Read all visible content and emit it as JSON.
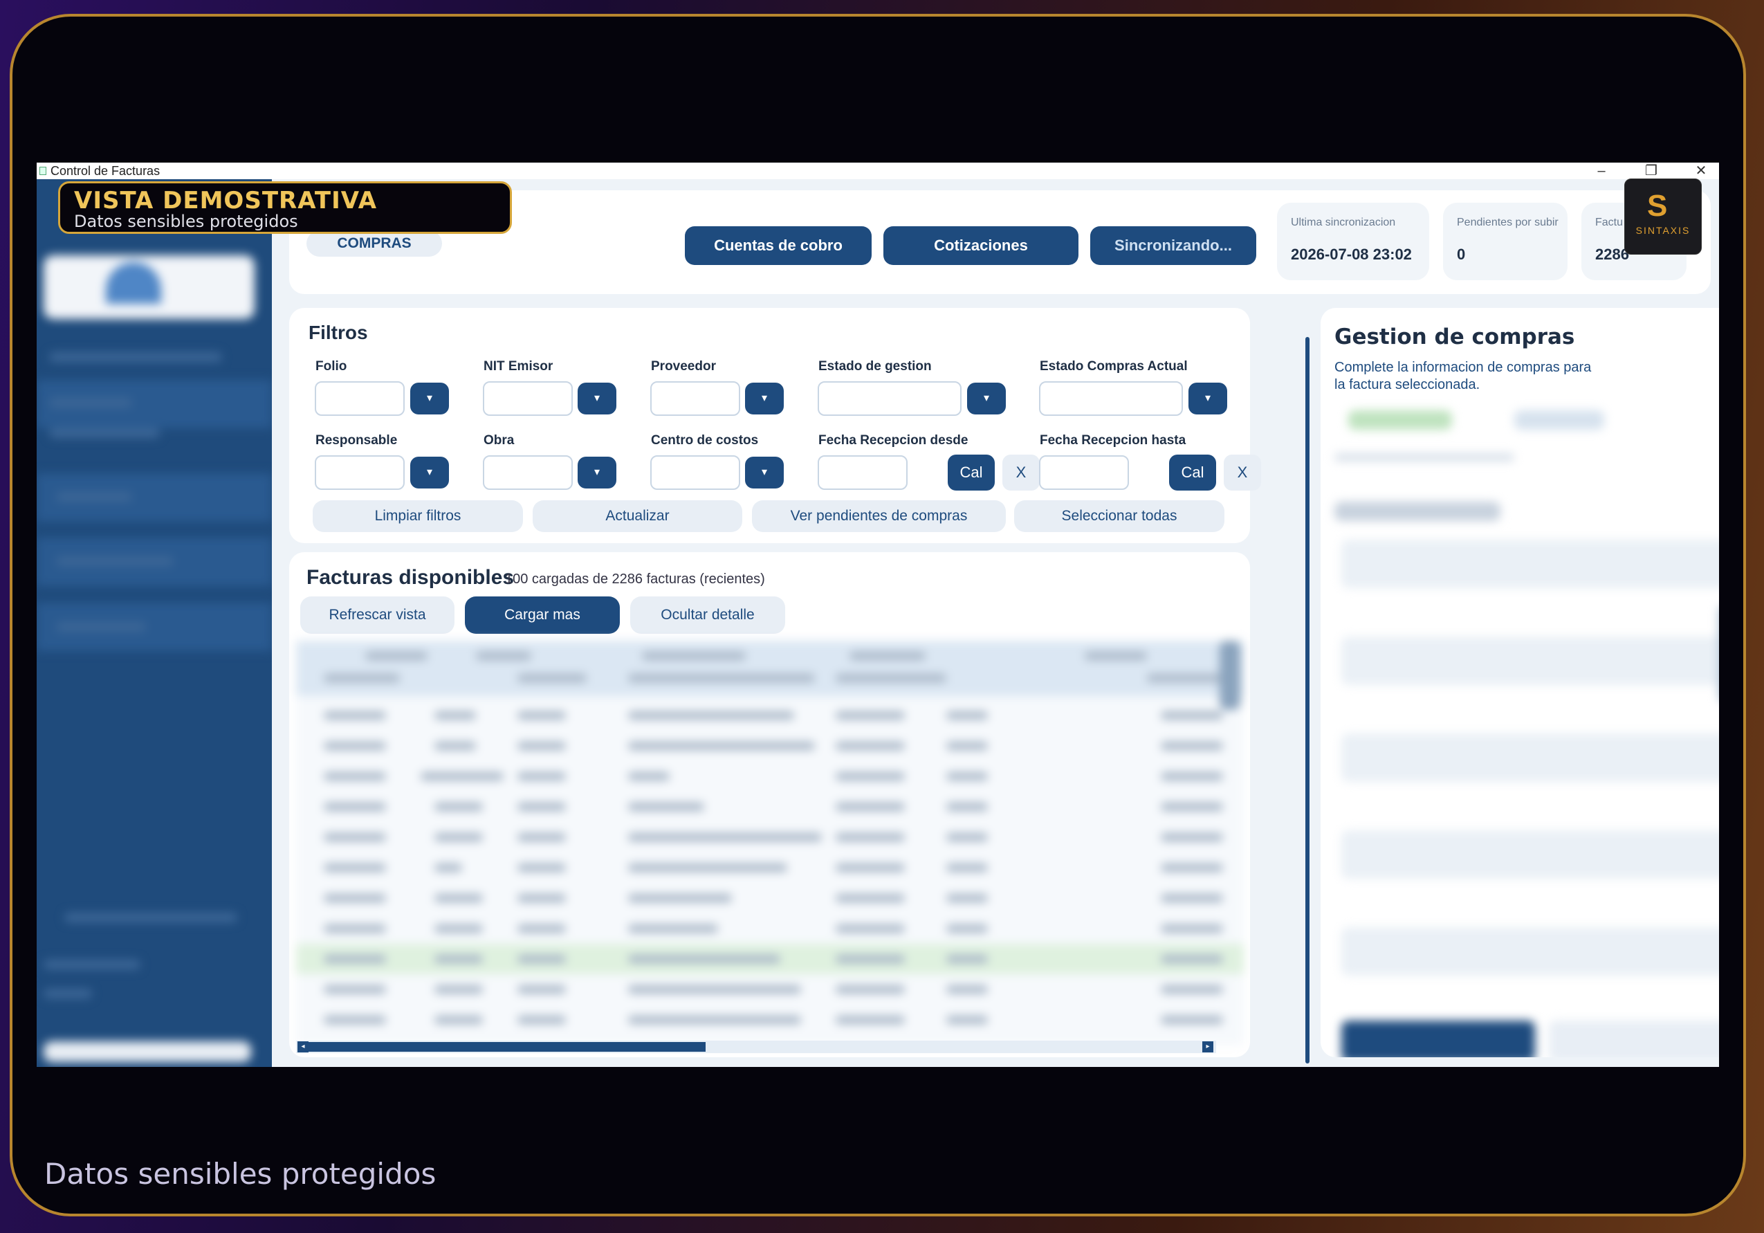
{
  "window": {
    "title": "Control de Facturas"
  },
  "demo_banner": {
    "title": "VISTA DEMOSTRATIVA",
    "subtitle": "Datos sensibles protegidos"
  },
  "footer_caption": "Datos sensibles protegidos",
  "header": {
    "section_pill": "COMPRAS",
    "buttons": {
      "cuentas": "Cuentas de cobro",
      "cotizaciones": "Cotizaciones",
      "sync": "Sincronizando..."
    },
    "stats": [
      {
        "label": "Ultima sincronizacion",
        "value": "2026-07-08 23:02"
      },
      {
        "label": "Pendientes por subir",
        "value": "0"
      },
      {
        "label": "Factu",
        "value": "2286"
      }
    ]
  },
  "brand_logo": {
    "text": "SINTAXIS"
  },
  "filters": {
    "title": "Filtros",
    "fields": {
      "folio": "Folio",
      "nit": "NIT Emisor",
      "proveedor": "Proveedor",
      "estado_gestion": "Estado de gestion",
      "estado_compras": "Estado Compras Actual",
      "responsable": "Responsable",
      "obra": "Obra",
      "centro": "Centro de costos",
      "fecha_desde": "Fecha Recepcion desde",
      "fecha_hasta": "Fecha Recepcion hasta"
    },
    "dropdown_glyph": "▾",
    "cal_label": "Cal",
    "clear_label": "X",
    "actions": {
      "limpiar": "Limpiar filtros",
      "actualizar": "Actualizar",
      "pendientes": "Ver pendientes de compras",
      "seleccionar": "Seleccionar todas"
    }
  },
  "facturas": {
    "title": "Facturas disponibles",
    "count": "100 cargadas de 2286 facturas (recientes)",
    "buttons": {
      "refrescar": "Refrescar vista",
      "cargar": "Cargar mas",
      "ocultar": "Ocultar detalle"
    },
    "scroll_left": "◂",
    "scroll_right": "▸"
  },
  "gestion": {
    "title": "Gestion de compras",
    "subtitle": "Complete la informacion de compras para la factura seleccionada."
  },
  "colors": {
    "primary": "#1e4b7e",
    "accent_gold": "#d6a63a",
    "sidebar": "#1f4b7c"
  }
}
